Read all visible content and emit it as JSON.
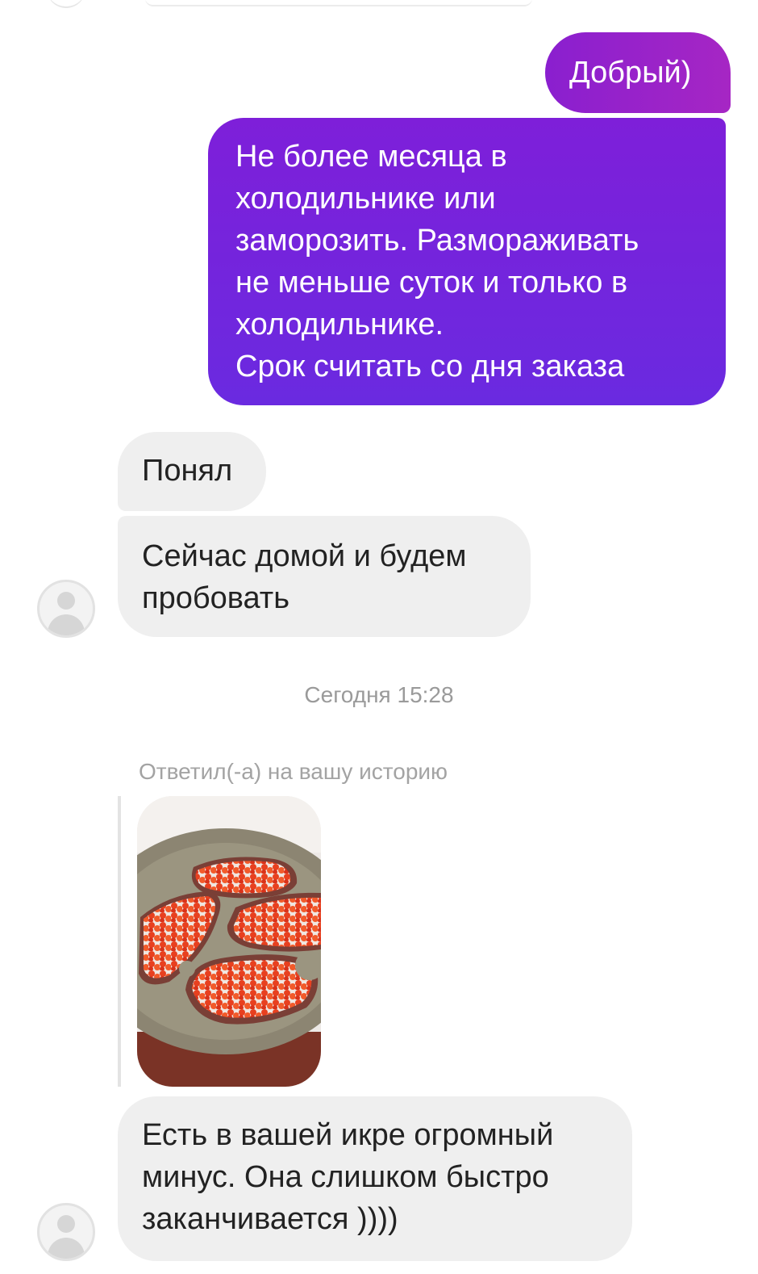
{
  "messages": {
    "outgoing": [
      {
        "lines": [
          "Добрый)"
        ]
      },
      {
        "lines": [
          "Не более месяца в",
          "холодильнике или",
          "заморозить. Размораживать",
          "не меньше суток и только в",
          "холодильнике.",
          "Срок считать со дня заказа"
        ]
      }
    ],
    "incoming": [
      {
        "lines": [
          "Понял"
        ]
      },
      {
        "lines": [
          "Сейчас домой и будем",
          "пробовать"
        ]
      },
      {
        "lines": [
          "Есть в вашей икре огромный",
          "минус. Она слишком быстро",
          "заканчивается ))))"
        ]
      }
    ]
  },
  "timestamp": "Сегодня 15:28",
  "story_reply": {
    "label": "Ответил(-а) на вашу историю",
    "image": "story-photo-caviar-sandwiches"
  },
  "colors": {
    "outgoing_bubble_start": "#8a1fcf",
    "outgoing_bubble_end": "#6a2ae0",
    "incoming_bubble": "#efefef",
    "meta_text": "#9a9a9a"
  },
  "icons": {
    "avatar": "default-user-avatar-icon"
  }
}
